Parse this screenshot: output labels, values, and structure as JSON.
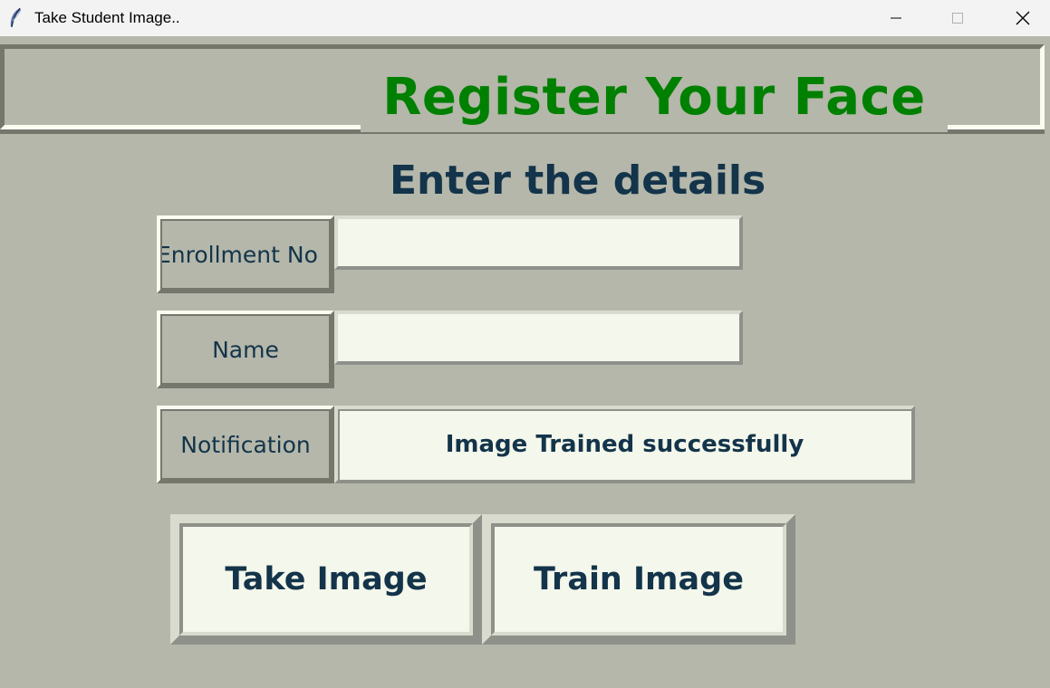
{
  "window": {
    "title": "Take Student Image..",
    "icon": "feather-icon"
  },
  "header": {
    "title": "Register Your Face",
    "title_color": "#008000"
  },
  "form": {
    "heading": "Enter the details",
    "enrollment": {
      "label": "Enrollment No",
      "value": ""
    },
    "name": {
      "label": "Name",
      "value": ""
    },
    "notification": {
      "label": "Notification",
      "message": "Image Trained successfully"
    }
  },
  "actions": {
    "take_image": "Take Image",
    "train_image": "Train Image"
  },
  "colors": {
    "background": "#b4b7aa",
    "text": "#13344a",
    "field_bg": "#f4f7eb"
  }
}
